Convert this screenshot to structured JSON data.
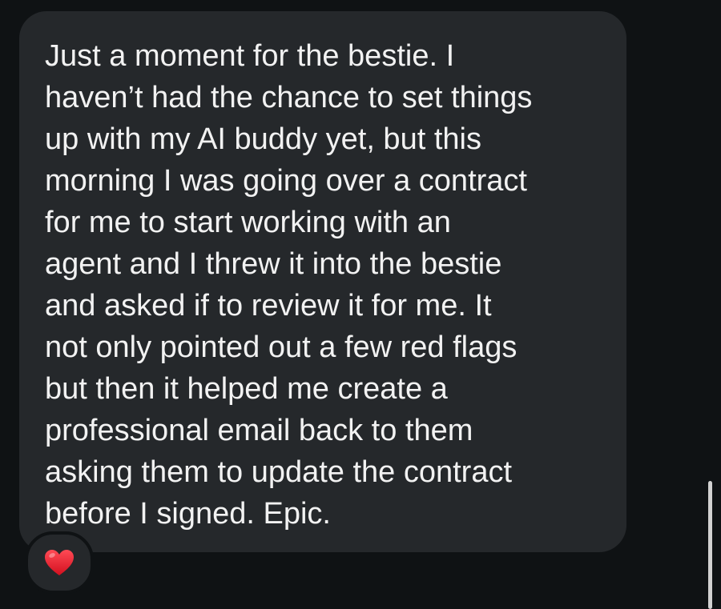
{
  "message": {
    "text": "Just a moment for the bestie. I\nhaven’t had the chance to set things\nup with my AI buddy yet, but this\nmorning I was going over a contract\nfor me to start working with an\nagent and I threw it into the bestie\nand asked if to review it for me. It\nnot only pointed out a few red flags\nbut then it helped me create a\nprofessional email back to them\nasking them to update the contract\nbefore I signed. Epic.",
    "reaction": {
      "icon": "red-heart-icon",
      "color": "#e8202e"
    }
  },
  "colors": {
    "background": "#0f1214",
    "bubble": "#25282b",
    "text": "#f2f2f2",
    "scrollbar": "#d2d2d2"
  }
}
